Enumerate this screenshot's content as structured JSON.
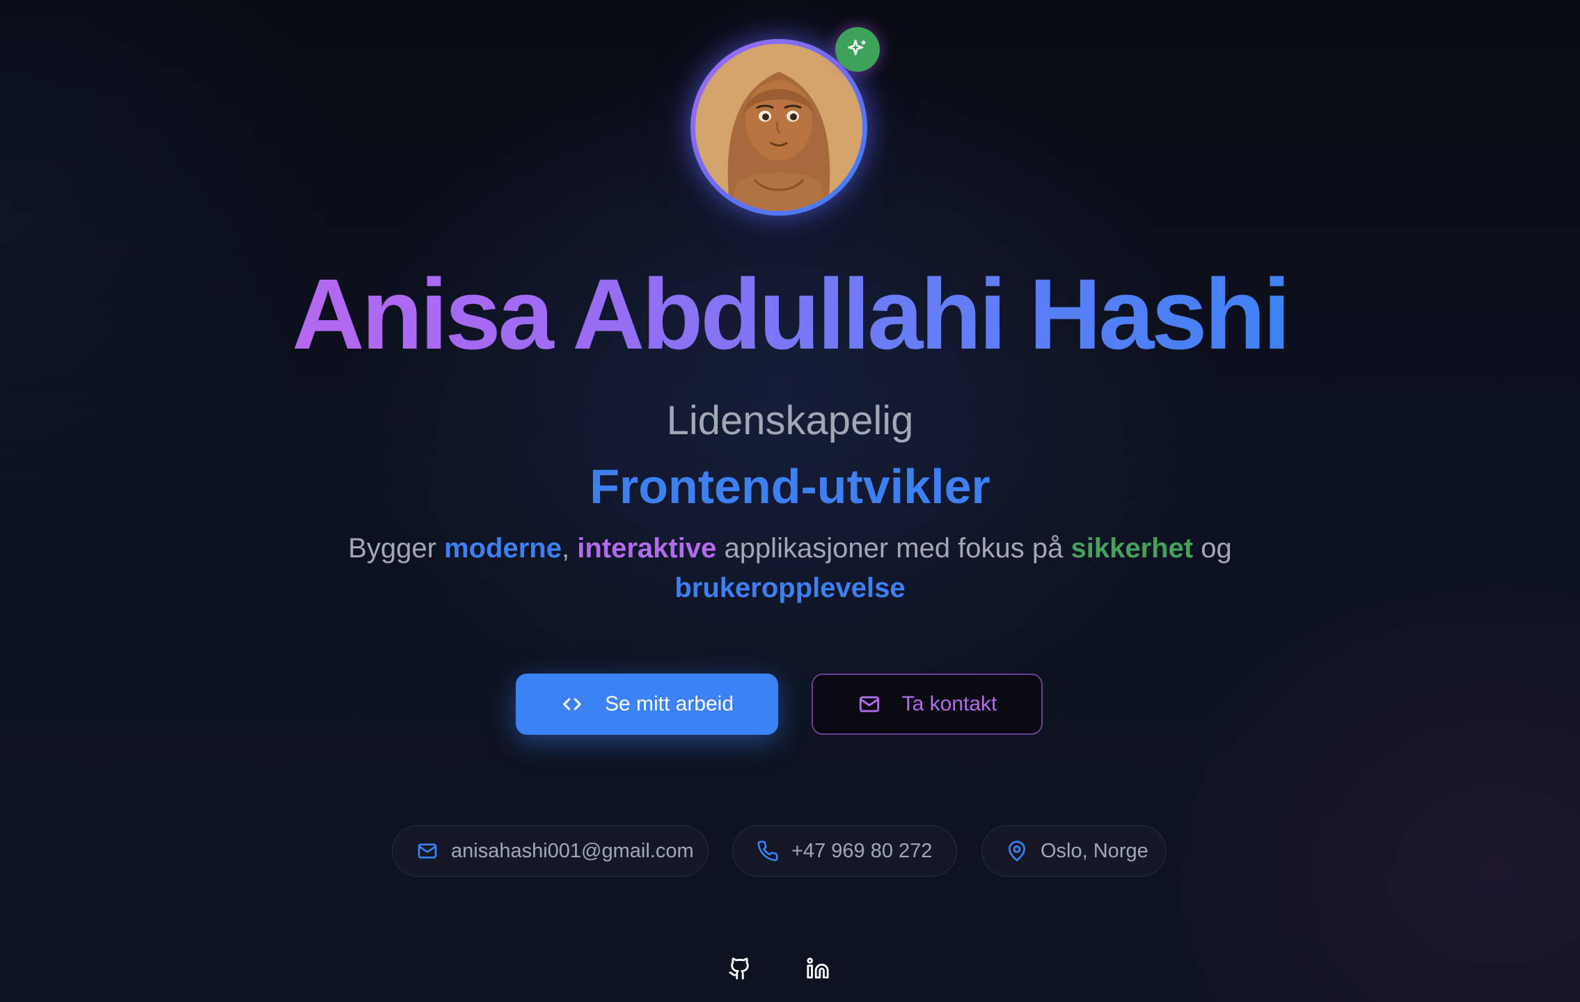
{
  "profile": {
    "name": "Anisa Abdullahi Hashi",
    "subtitle": "Lidenskapelig",
    "role": "Frontend-utvikler",
    "avatar_icon": "avatar-illustration",
    "badge_icon": "sparkle-icon"
  },
  "tagline": {
    "part1": "Bygger ",
    "word1": "moderne",
    "part2": ", ",
    "word2": "interaktive",
    "part3": " applikasjoner med fokus på ",
    "word3": "sikkerhet",
    "part4": " og ",
    "word4": "brukeropplevelse"
  },
  "buttons": {
    "primary_label": "Se mitt arbeid",
    "primary_icon": "code-icon",
    "secondary_label": "Ta kontakt",
    "secondary_icon": "mail-icon"
  },
  "contact": {
    "email": "anisahashi001@gmail.com",
    "phone": "+47 969 80 272",
    "location": "Oslo, Norge"
  },
  "social": {
    "github_icon": "github-icon",
    "linkedin_icon": "linkedin-icon"
  },
  "colors": {
    "background": "#0b0f1a",
    "accent_blue": "#3b82f6",
    "accent_purple": "#b36cee",
    "accent_green": "#45a25d",
    "muted_text": "#a3a8b6"
  }
}
